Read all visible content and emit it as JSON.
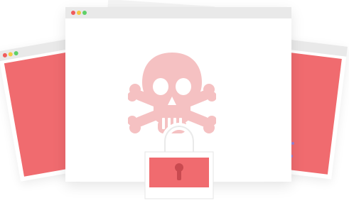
{
  "colors": {
    "window_red": "#f06b6f",
    "titlebar": "#e9e9e9",
    "skull": "#f5c1c2",
    "lock_body": "#f06b6f",
    "keyhole": "#c94a50",
    "dot_red": "#f05b5b",
    "dot_yellow": "#f5c842",
    "dot_green": "#5fd068",
    "accent_purple": "#9b7fd1"
  },
  "illustration": {
    "main_icon": "skull-crossbones-icon",
    "lock_icon": "padlock-icon"
  }
}
